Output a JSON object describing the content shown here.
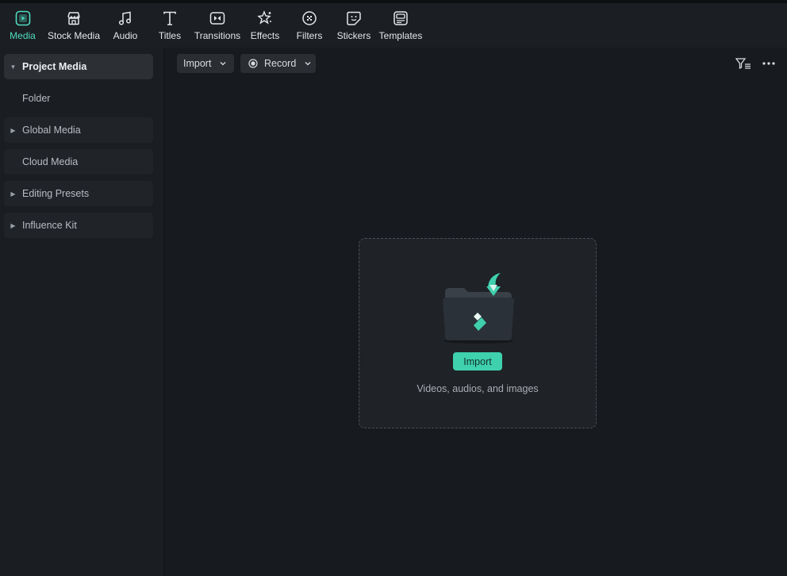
{
  "toolbar": {
    "tabs": [
      {
        "label": "Media",
        "icon": "media-icon",
        "active": true
      },
      {
        "label": "Stock Media",
        "icon": "stock-media-icon"
      },
      {
        "label": "Audio",
        "icon": "music-note-icon"
      },
      {
        "label": "Titles",
        "icon": "titles-t-icon"
      },
      {
        "label": "Transitions",
        "icon": "transitions-icon"
      },
      {
        "label": "Effects",
        "icon": "effects-icon"
      },
      {
        "label": "Filters",
        "icon": "filters-icon"
      },
      {
        "label": "Stickers",
        "icon": "stickers-icon"
      },
      {
        "label": "Templates",
        "icon": "templates-icon"
      }
    ]
  },
  "sidebar": {
    "items": [
      {
        "label": "Project Media"
      },
      {
        "label": "Folder"
      },
      {
        "label": "Global Media"
      },
      {
        "label": "Cloud Media"
      },
      {
        "label": "Editing Presets"
      },
      {
        "label": "Influence Kit"
      }
    ]
  },
  "actions": {
    "import_label": "Import",
    "record_label": "Record"
  },
  "dropzone": {
    "import_label": "Import",
    "hint": "Videos, audios, and images"
  },
  "colors": {
    "accent": "#3fd0ae",
    "background": "#16191d"
  }
}
